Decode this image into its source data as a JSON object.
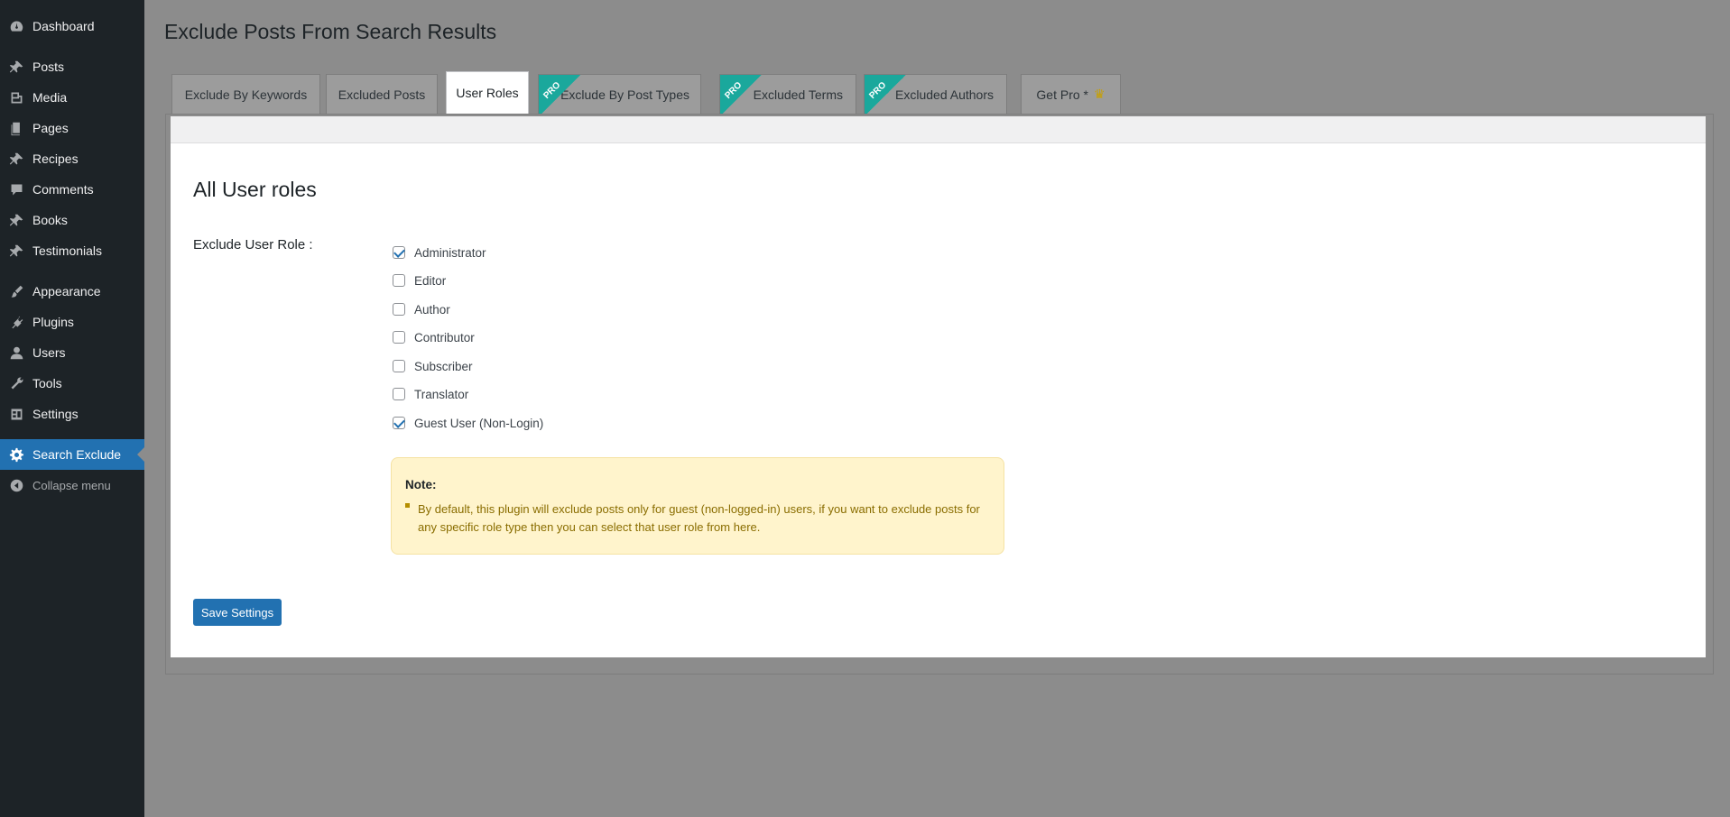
{
  "sidebar": {
    "items": [
      {
        "label": "Dashboard",
        "icon": "dashboard-icon"
      },
      {
        "label": "Posts",
        "icon": "pin-icon"
      },
      {
        "label": "Media",
        "icon": "media-icon"
      },
      {
        "label": "Pages",
        "icon": "pages-icon"
      },
      {
        "label": "Recipes",
        "icon": "pin-icon"
      },
      {
        "label": "Comments",
        "icon": "comment-icon"
      },
      {
        "label": "Books",
        "icon": "pin-icon"
      },
      {
        "label": "Testimonials",
        "icon": "pin-icon"
      },
      {
        "label": "Appearance",
        "icon": "brush-icon"
      },
      {
        "label": "Plugins",
        "icon": "plug-icon"
      },
      {
        "label": "Users",
        "icon": "user-icon"
      },
      {
        "label": "Tools",
        "icon": "wrench-icon"
      },
      {
        "label": "Settings",
        "icon": "settings-icon"
      },
      {
        "label": "Search Exclude",
        "icon": "gear-icon",
        "active": true
      },
      {
        "label": "Collapse menu",
        "icon": "collapse-icon"
      }
    ]
  },
  "page": {
    "title": "Exclude Posts From Search Results"
  },
  "tabs": [
    {
      "label": "Exclude By Keywords",
      "pro": false
    },
    {
      "label": "Excluded Posts",
      "pro": false
    },
    {
      "label": "User Roles",
      "pro": false,
      "active": true
    },
    {
      "label": "Exclude By Post Types",
      "pro": true
    },
    {
      "label": "Excluded Terms",
      "pro": true
    },
    {
      "label": "Excluded Authors",
      "pro": true
    },
    {
      "label": "Get Pro *",
      "pro": false
    }
  ],
  "pro_badge": "PRO",
  "crown_icon": "♛",
  "section": {
    "title": "All User roles",
    "field_label": "Exclude User Role :"
  },
  "roles": [
    {
      "label": "Administrator",
      "checked": true
    },
    {
      "label": "Editor",
      "checked": false
    },
    {
      "label": "Author",
      "checked": false
    },
    {
      "label": "Contributor",
      "checked": false
    },
    {
      "label": "Subscriber",
      "checked": false
    },
    {
      "label": "Translator",
      "checked": false
    },
    {
      "label": "Guest User (Non-Login)",
      "checked": true
    }
  ],
  "note": {
    "title": "Note:",
    "text": "By default, this plugin will exclude posts only for guest (non-logged-in) users, if you want to exclude posts for any specific role type then you can select that user role from here."
  },
  "save_label": "Save Settings",
  "colors": {
    "sidebar_bg": "#1d2327",
    "accent": "#2271b1",
    "pro_ribbon": "#1aa89c",
    "note_bg": "#fff4cc",
    "note_text": "#8a6d00"
  }
}
